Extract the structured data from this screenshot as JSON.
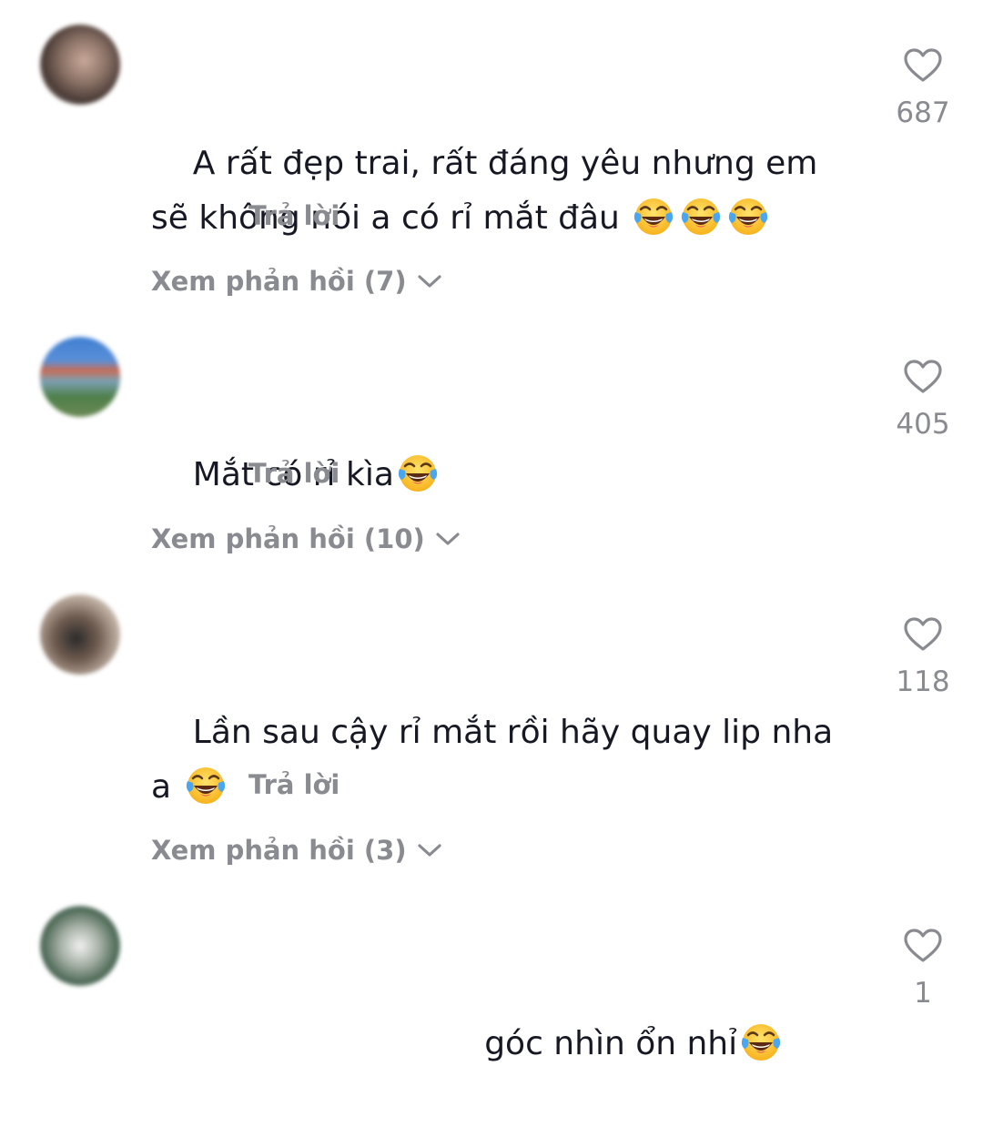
{
  "comments": [
    {
      "text": "A rất đẹp trai, rất đáng yêu nhưng em sẽ không nói a có rỉ mắt đâu ",
      "emojis": 3,
      "reply_label": "Trả lời",
      "view_replies_label": "Xem phản hồi (7)",
      "likes": "687"
    },
    {
      "text": "Mắt có rỉ kìa",
      "emojis": 1,
      "reply_label": "Trả lời",
      "view_replies_label": "Xem phản hồi (10)",
      "likes": "405"
    },
    {
      "text": "Lần sau cậy rỉ mắt rồi hãy quay lip nha a ",
      "emojis": 1,
      "reply_label": "Trả lời",
      "view_replies_label": "Xem phản hồi (3)",
      "likes": "118"
    },
    {
      "text": "                            góc nhìn ổn nhỉ",
      "emojis": 1,
      "likes": "1"
    }
  ],
  "icons": {
    "like": "heart-outline-icon",
    "emoji": "face-with-tears-of-joy-emoji",
    "expand": "chevron-down-icon"
  },
  "colors": {
    "text": "#161823",
    "muted": "#8a8b91"
  }
}
